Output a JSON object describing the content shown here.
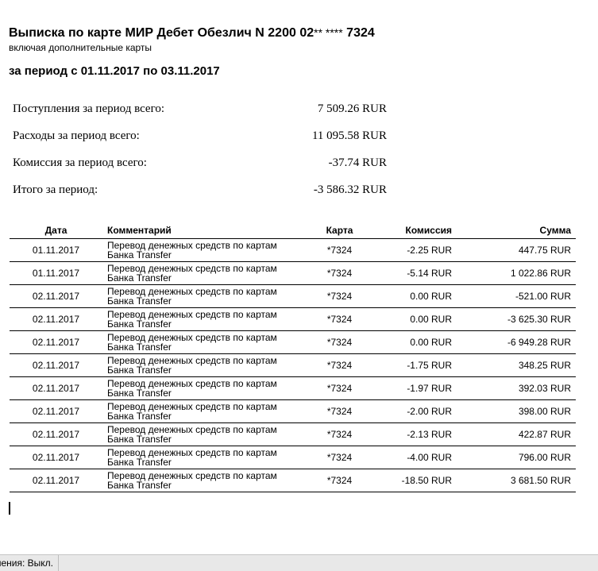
{
  "document": {
    "title_main": "Выписка по карте МИР Дебет Обезлич N 2200 02",
    "title_mask": "** ****",
    "title_tail": " 7324",
    "subtitle": "включая дополнительные карты",
    "period": "за период с 01.11.2017 по 03.11.2017"
  },
  "summary": [
    {
      "label": "Поступления за период всего:",
      "value": "7 509.26 RUR"
    },
    {
      "label": "Расходы за период всего:",
      "value": "11 095.58 RUR"
    },
    {
      "label": "Комиссия за период всего:",
      "value": "-37.74 RUR"
    },
    {
      "label": "Итого за период:",
      "value": "-3 586.32 RUR"
    }
  ],
  "table": {
    "headers": {
      "date": "Дата",
      "comment": "Комментарий",
      "card": "Карта",
      "fee": "Комиссия",
      "sum": "Сумма"
    },
    "rows": [
      {
        "date": "01.11.2017",
        "comment_l1": "Перевод денежных средств по картам",
        "comment_l2": "Банка Transfer",
        "card": "*7324",
        "fee": "-2.25 RUR",
        "sum": "447.75 RUR"
      },
      {
        "date": "01.11.2017",
        "comment_l1": "Перевод денежных средств по картам",
        "comment_l2": "Банка Transfer",
        "card": "*7324",
        "fee": "-5.14 RUR",
        "sum": "1 022.86 RUR"
      },
      {
        "date": "02.11.2017",
        "comment_l1": "Перевод денежных средств по картам",
        "comment_l2": "Банка Transfer",
        "card": "*7324",
        "fee": "0.00 RUR",
        "sum": "-521.00 RUR"
      },
      {
        "date": "02.11.2017",
        "comment_l1": "Перевод денежных средств по картам",
        "comment_l2": "Банка Transfer",
        "card": "*7324",
        "fee": "0.00 RUR",
        "sum": "-3 625.30 RUR"
      },
      {
        "date": "02.11.2017",
        "comment_l1": "Перевод денежных средств по картам",
        "comment_l2": "Банка Transfer",
        "card": "*7324",
        "fee": "0.00 RUR",
        "sum": "-6 949.28 RUR"
      },
      {
        "date": "02.11.2017",
        "comment_l1": "Перевод денежных средств по картам",
        "comment_l2": "Банка Transfer",
        "card": "*7324",
        "fee": "-1.75 RUR",
        "sum": "348.25 RUR"
      },
      {
        "date": "02.11.2017",
        "comment_l1": "Перевод денежных средств по картам",
        "comment_l2": "Банка Transfer",
        "card": "*7324",
        "fee": "-1.97 RUR",
        "sum": "392.03 RUR"
      },
      {
        "date": "02.11.2017",
        "comment_l1": "Перевод денежных средств по картам",
        "comment_l2": "Банка Transfer",
        "card": "*7324",
        "fee": "-2.00 RUR",
        "sum": "398.00 RUR"
      },
      {
        "date": "02.11.2017",
        "comment_l1": "Перевод денежных средств по картам",
        "comment_l2": "Банка Transfer",
        "card": "*7324",
        "fee": "-2.13 RUR",
        "sum": "422.87 RUR"
      },
      {
        "date": "02.11.2017",
        "comment_l1": "Перевод денежных средств по картам",
        "comment_l2": "Банка Transfer",
        "card": "*7324",
        "fee": "-4.00 RUR",
        "sum": "796.00 RUR"
      },
      {
        "date": "02.11.2017",
        "comment_l1": "Перевод денежных средств по картам",
        "comment_l2": "Банка Transfer",
        "card": "*7324",
        "fee": "-18.50 RUR",
        "sum": "3 681.50 RUR"
      }
    ]
  },
  "statusbar": {
    "item": "нения: Выкл."
  }
}
